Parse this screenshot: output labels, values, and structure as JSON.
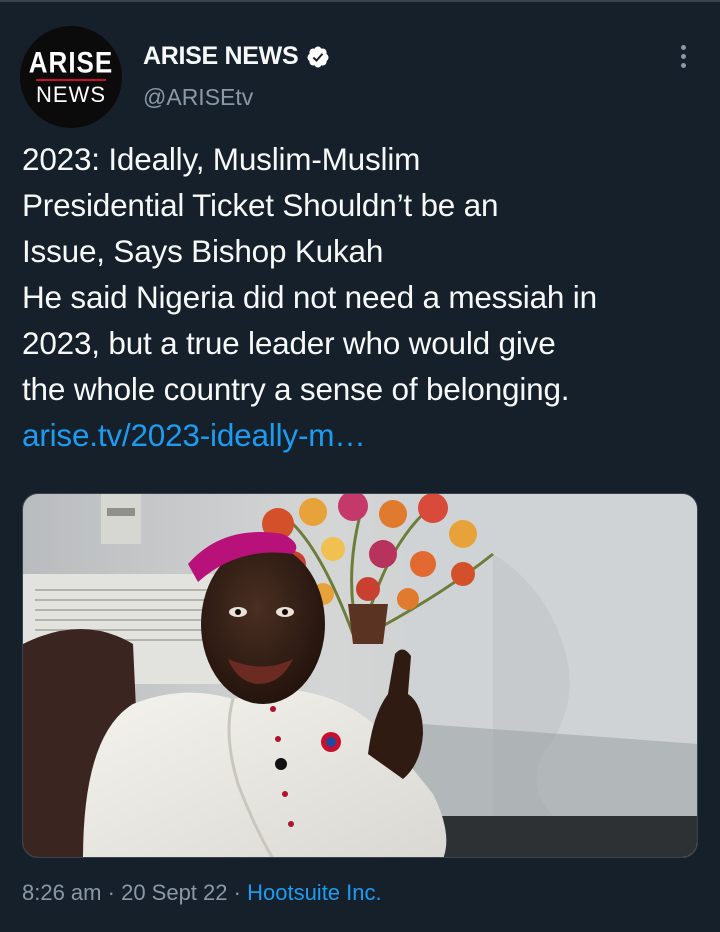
{
  "account": {
    "avatar_top": "ARISE",
    "avatar_bottom": "NEWS",
    "display_name": "ARISE NEWS",
    "handle": "@ARISEtv",
    "verified": true
  },
  "tweet": {
    "lines": [
      "2023: Ideally, Muslim-Muslim",
      "Presidential Ticket Shouldn’t be an",
      "Issue, Says Bishop Kukah",
      "He said Nigeria did not need a messiah in",
      "2023, but a true leader who would give",
      "the whole country a sense of belonging."
    ],
    "link": "arise.tv/2023-ideally-m…"
  },
  "meta": {
    "time": "8:26 am",
    "separator": "·",
    "date": "20 Sept 22",
    "source": "Hootsuite Inc."
  },
  "icons": {
    "verified": "verified-badge-icon",
    "more": "more-options-icon"
  },
  "colors": {
    "background": "#15202b",
    "link": "#1d9bf0",
    "secondary_text": "#8b98a5"
  }
}
